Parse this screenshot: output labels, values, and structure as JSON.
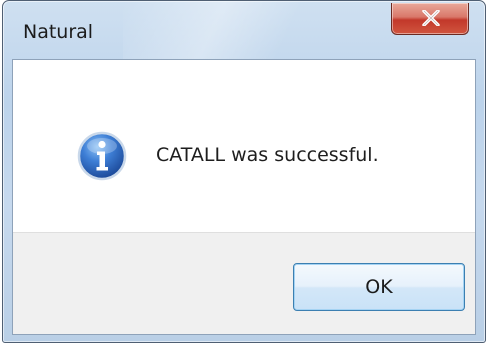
{
  "window": {
    "title": "Natural"
  },
  "message": {
    "text": "CATALL was successful.",
    "icon": "info-icon"
  },
  "buttons": {
    "ok_label": "OK",
    "close_icon": "close-icon"
  },
  "colors": {
    "close_button": "#c8412f",
    "ok_border": "#3c7fb1",
    "info_icon": "#2a63b8"
  }
}
